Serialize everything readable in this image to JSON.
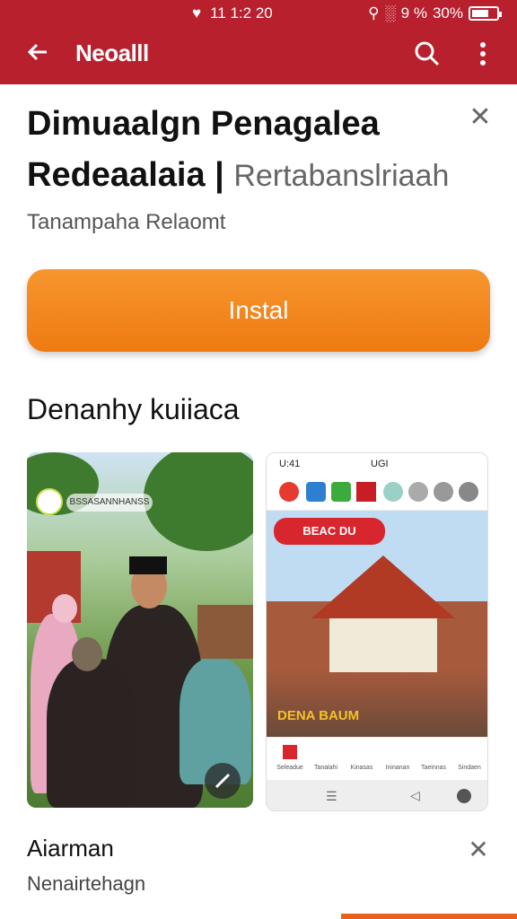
{
  "status_bar": {
    "time": "11 1:2 20",
    "battery": "30%",
    "signal_text": "9 %"
  },
  "app_bar": {
    "title": "Neoalll",
    "back_icon": "arrow-left-icon",
    "search_icon": "search-icon",
    "more_icon": "more-vert-icon"
  },
  "headline": {
    "line1": "Dimuaalgn Penagalea",
    "line2_main": "Redeaalaia |",
    "line2_sub": "Rertabanslriaah"
  },
  "meta": "Tanampaha Relaomt",
  "install_label": "Instal",
  "section_title": "Denanhy kuiiaca",
  "screenshot2": {
    "time": "U:41",
    "carrier": "UGI",
    "badge": "BEAC DU",
    "overlay_text": "DENA BAUM",
    "nav_items": [
      "Seleadue",
      "Tanalahi",
      "Kinasas",
      "Ininanan",
      "Taeinnas",
      "Sindaen"
    ]
  },
  "screenshot1": {
    "label": "BSSASANNHANSS"
  },
  "footer": {
    "title": "Aiarman",
    "subtitle": "Nenairtehagn"
  }
}
